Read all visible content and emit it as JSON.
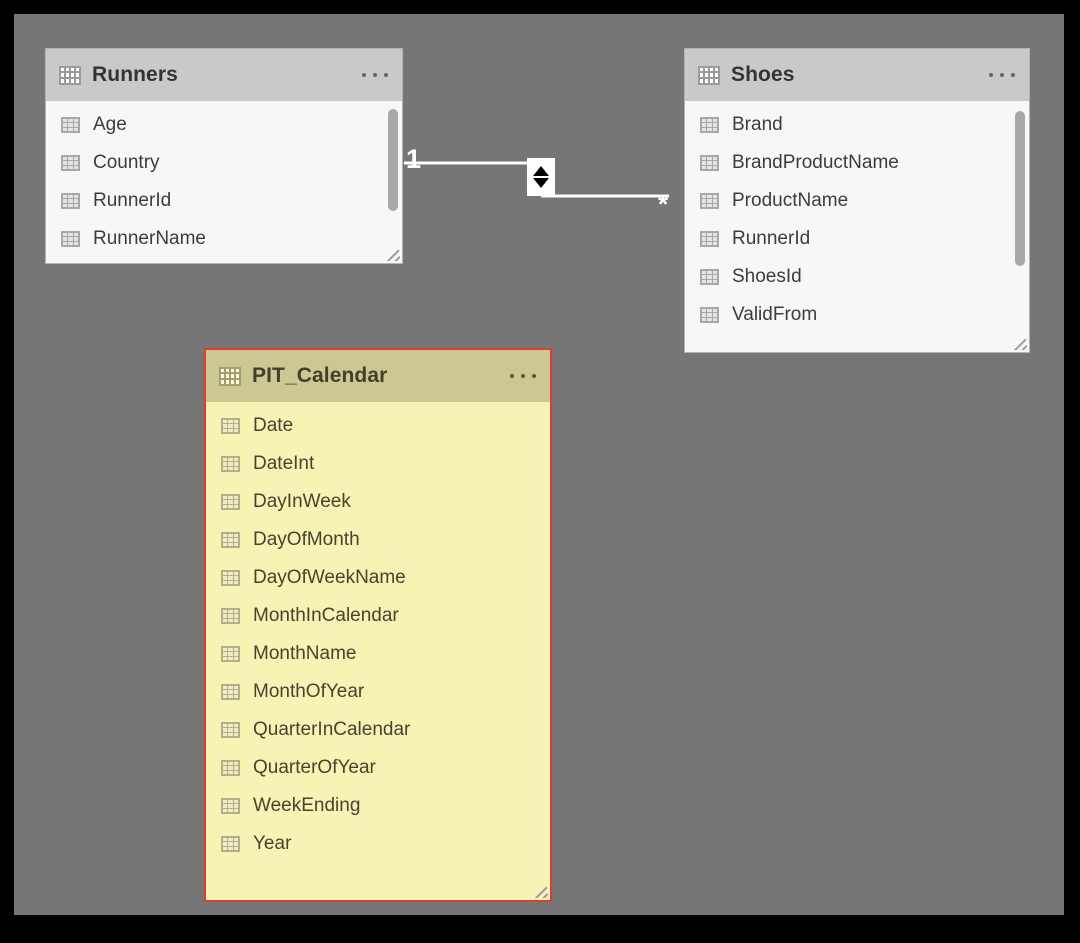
{
  "canvas": {
    "background": "#767676",
    "frame_color": "#000000"
  },
  "tables": [
    {
      "name": "Runners",
      "menu_label": "...",
      "highlighted": false,
      "fields": [
        "Age",
        "Country",
        "RunnerId",
        "RunnerName"
      ]
    },
    {
      "name": "Shoes",
      "menu_label": "...",
      "highlighted": false,
      "fields": [
        "Brand",
        "BrandProductName",
        "ProductName",
        "RunnerId",
        "ShoesId",
        "ValidFrom"
      ]
    },
    {
      "name": "PIT_Calendar",
      "menu_label": "...",
      "highlighted": true,
      "highlight_border_color": "#e03c31",
      "highlight_header_color": "#cbc894",
      "highlight_body_color": "#f6f3b4",
      "fields": [
        "Date",
        "DateInt",
        "DayInWeek",
        "DayOfMonth",
        "DayOfWeekName",
        "MonthInCalendar",
        "MonthName",
        "MonthOfYear",
        "QuarterInCalendar",
        "QuarterOfYear",
        "WeekEnding",
        "Year"
      ]
    }
  ],
  "relationship": {
    "from_table": "Runners",
    "to_table": "Shoes",
    "from_cardinality": "1",
    "to_cardinality": "*",
    "cross_filter": "both",
    "line_color": "#ffffff"
  }
}
